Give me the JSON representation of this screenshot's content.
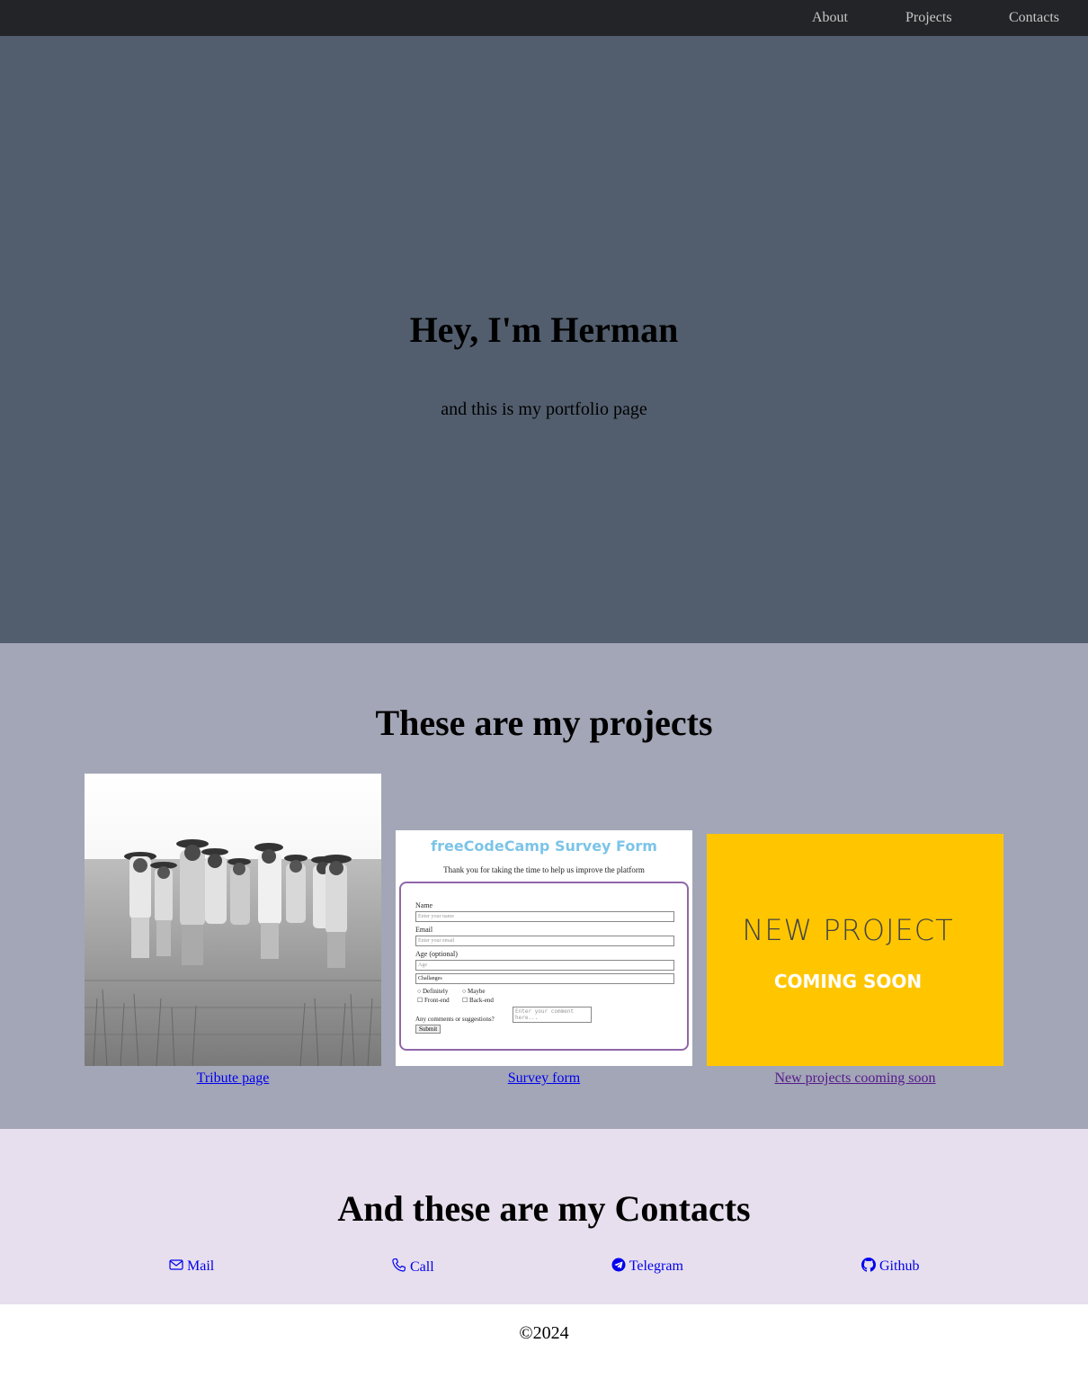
{
  "nav": {
    "about": "About",
    "projects": "Projects",
    "contacts": "Contacts"
  },
  "welcome": {
    "heading": "Hey, I'm Herman",
    "subtitle": "and this is my portfolio page"
  },
  "projects": {
    "heading": "These are my projects",
    "tiles": [
      {
        "link": "Tribute page",
        "image": "black-and-white photo of men standing in a wheat field"
      },
      {
        "link": "Survey form",
        "image": "screenshot of survey form"
      },
      {
        "link": "New projects cooming soon",
        "image": "new project coming soon banner"
      }
    ],
    "survey_preview": {
      "title": "freeCodeCamp Survey Form",
      "description": "Thank you for taking the time to help us improve the platform",
      "name_label": "Name",
      "name_placeholder": "Enter your name",
      "email_label": "Email",
      "email_placeholder": "Enter your email",
      "age_label": "Age (optional)",
      "age_placeholder": "Age",
      "select_value": "Challanges",
      "radio_1": "Definitely",
      "radio_2": "Maybe",
      "check_1": "Front-end",
      "check_2": "Back-end",
      "comments_label": "Any comments or suggestions?",
      "comments_placeholder": "Enter your comment here...",
      "submit": "Submit"
    },
    "coming_soon": {
      "line1": "NEW PROJECT",
      "line2": "COMING SOON",
      "bg_color": "#ffc600"
    }
  },
  "contacts": {
    "heading": "And these are my Contacts",
    "items": [
      {
        "label": "Mail",
        "icon": "envelope-icon"
      },
      {
        "label": "Call",
        "icon": "phone-icon"
      },
      {
        "label": "Telegram",
        "icon": "telegram-icon"
      },
      {
        "label": "Github",
        "icon": "github-icon"
      }
    ]
  },
  "footer": {
    "text": "©2024"
  },
  "colors": {
    "navbar": "#232427",
    "welcome": "#525e6e",
    "projects": "#a3a6b6",
    "contacts": "#e7dfed",
    "link": "#0000ee",
    "visited": "#551a8b"
  }
}
